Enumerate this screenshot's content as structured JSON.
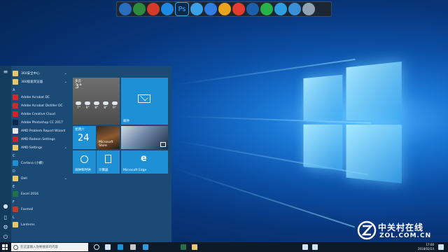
{
  "dock": {
    "icons": [
      "laptop-icon",
      "arrow-up-icon",
      "swirl-icon",
      "refresh-icon",
      "photoshop-icon",
      "clover-icon",
      "feather-icon",
      "color-wheel-icon",
      "weibo-icon",
      "gauge-icon",
      "wechat-icon",
      "star-icon",
      "globe-icon",
      "recycle-bin-icon"
    ],
    "photoshop_label": "Ps"
  },
  "start_menu": {
    "apps": [
      {
        "label": "360安全中心",
        "icon": "folder-icon",
        "chevron": true
      },
      {
        "label": "360极速浏览器",
        "icon": "folder-icon",
        "chevron": true
      },
      {
        "letter": "A"
      },
      {
        "label": "Adobe Acrobat DC",
        "icon": "acrobat-icon"
      },
      {
        "label": "Adobe Acrobat Distiller DC",
        "icon": "distiller-icon"
      },
      {
        "label": "Adobe Creative Cloud",
        "icon": "creative-cloud-icon"
      },
      {
        "label": "Adobe Photoshop CC 2017",
        "icon": "photoshop-icon"
      },
      {
        "label": "AMD Problem Report Wizard",
        "icon": "amd-icon"
      },
      {
        "label": "AMD Radeon Settings",
        "icon": "radeon-icon"
      },
      {
        "label": "AMD Settings",
        "icon": "folder-icon",
        "chevron": true
      },
      {
        "letter": "C"
      },
      {
        "label": "Cortana (小娜)",
        "icon": "cortana-icon"
      },
      {
        "letter": "D"
      },
      {
        "label": "Dell",
        "icon": "folder-icon",
        "chevron": true
      },
      {
        "letter": "E"
      },
      {
        "label": "Excel 2016",
        "icon": "excel-icon"
      },
      {
        "letter": "F"
      },
      {
        "label": "Foxmail",
        "icon": "foxmail-icon"
      },
      {
        "letter": "L"
      },
      {
        "label": "Lanterns",
        "icon": "folder-icon"
      }
    ],
    "tiles": {
      "weather_city": "多云",
      "weather_temp": "3°",
      "weather_days": [
        "7°",
        "9°",
        "8°",
        "8°",
        "9°"
      ],
      "mail_label": "邮件",
      "calendar_weekday": "星期六",
      "calendar_day": "24",
      "photos_label": "Microsoft Store",
      "alarm_label": "闹钟和时钟",
      "calc_label": "计算器",
      "edge_label": "Microsoft Edge"
    }
  },
  "taskbar": {
    "search_placeholder": "在这里输入你要搜索的内容",
    "clock_time": "17:00",
    "clock_date": "2018/02/24"
  },
  "watermark": {
    "cn": "中关村在线",
    "en": "ZOL.COM.CN"
  }
}
